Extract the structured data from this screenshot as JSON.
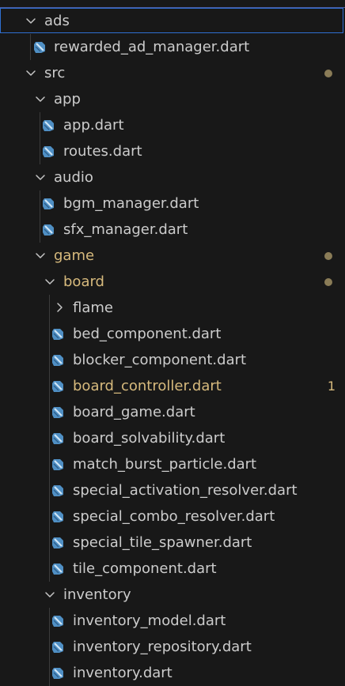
{
  "explorer": {
    "rows": [
      {
        "label": "ads",
        "kind": "folder-open",
        "depth": 1
      },
      {
        "label": "rewarded_ad_manager.dart",
        "kind": "dart",
        "depth": 2
      },
      {
        "label": "src",
        "kind": "folder-open",
        "depth": 1,
        "decoration": "dot"
      },
      {
        "label": "app",
        "kind": "folder-open",
        "depth": 2
      },
      {
        "label": "app.dart",
        "kind": "dart",
        "depth": 3
      },
      {
        "label": "routes.dart",
        "kind": "dart",
        "depth": 3
      },
      {
        "label": "audio",
        "kind": "folder-open",
        "depth": 2
      },
      {
        "label": "bgm_manager.dart",
        "kind": "dart",
        "depth": 3
      },
      {
        "label": "sfx_manager.dart",
        "kind": "dart",
        "depth": 3
      },
      {
        "label": "game",
        "kind": "folder-open",
        "depth": 2,
        "modified": true,
        "decoration": "dot"
      },
      {
        "label": "board",
        "kind": "folder-open",
        "depth": 3,
        "modified": true,
        "decoration": "dot"
      },
      {
        "label": "flame",
        "kind": "folder-closed",
        "depth": 4
      },
      {
        "label": "bed_component.dart",
        "kind": "dart",
        "depth": 4
      },
      {
        "label": "blocker_component.dart",
        "kind": "dart",
        "depth": 4
      },
      {
        "label": "board_controller.dart",
        "kind": "dart",
        "depth": 4,
        "modified": true,
        "badge": "1"
      },
      {
        "label": "board_game.dart",
        "kind": "dart",
        "depth": 4
      },
      {
        "label": "board_solvability.dart",
        "kind": "dart",
        "depth": 4
      },
      {
        "label": "match_burst_particle.dart",
        "kind": "dart",
        "depth": 4
      },
      {
        "label": "special_activation_resolver.dart",
        "kind": "dart",
        "depth": 4
      },
      {
        "label": "special_combo_resolver.dart",
        "kind": "dart",
        "depth": 4
      },
      {
        "label": "special_tile_spawner.dart",
        "kind": "dart",
        "depth": 4
      },
      {
        "label": "tile_component.dart",
        "kind": "dart",
        "depth": 4
      },
      {
        "label": "inventory",
        "kind": "folder-open",
        "depth": 3
      },
      {
        "label": "inventory_model.dart",
        "kind": "dart",
        "depth": 4
      },
      {
        "label": "inventory_repository.dart",
        "kind": "dart",
        "depth": 4
      },
      {
        "label": "inventory.dart",
        "kind": "dart",
        "depth": 4
      }
    ]
  },
  "icons": {
    "folder_open": "chevron-down-icon",
    "folder_closed": "chevron-right-icon",
    "dart_file": "dart-file-icon",
    "modified_marker": "modified-dot-icon"
  },
  "colors": {
    "background": "#181818",
    "text": "#cccccc",
    "modified": "#d7ba7d",
    "dart_icon": "#5a9fd4",
    "focus_border": "#2f6fd1"
  }
}
